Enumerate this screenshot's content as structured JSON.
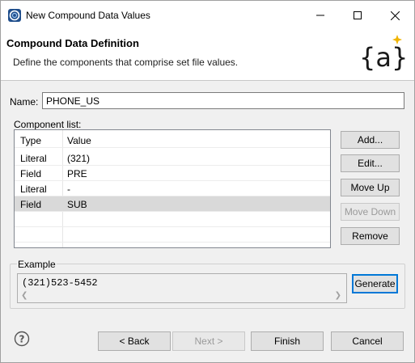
{
  "window": {
    "title": "New Compound Data Values",
    "controls": {
      "minimize": "minimize-icon",
      "maximize": "maximize-icon",
      "close": "close-icon"
    }
  },
  "banner": {
    "title": "Compound Data Definition",
    "description": "Define the components that comprise set file values.",
    "logo_text": "{a}"
  },
  "form": {
    "name_label": "Name:",
    "name_value": "PHONE_US",
    "component_list_label": "Component list:",
    "columns": [
      "Type",
      "Value"
    ],
    "rows": [
      {
        "type": "Literal",
        "value": "(321)",
        "selected": false
      },
      {
        "type": "Field",
        "value": "PRE",
        "selected": false
      },
      {
        "type": "Literal",
        "value": "-",
        "selected": false
      },
      {
        "type": "Field",
        "value": "SUB",
        "selected": true
      }
    ]
  },
  "side_buttons": {
    "add": "Add...",
    "edit": "Edit...",
    "move_up": "Move Up",
    "move_down": "Move Down",
    "remove": "Remove"
  },
  "example": {
    "label": "Example",
    "value": "(321)523-5452",
    "generate": "Generate"
  },
  "footer": {
    "back": "< Back",
    "next": "Next >",
    "finish": "Finish",
    "cancel": "Cancel"
  },
  "colors": {
    "selection": "#d9d9d9",
    "focus": "#0078d7",
    "logo_accent": "#f0b400"
  }
}
